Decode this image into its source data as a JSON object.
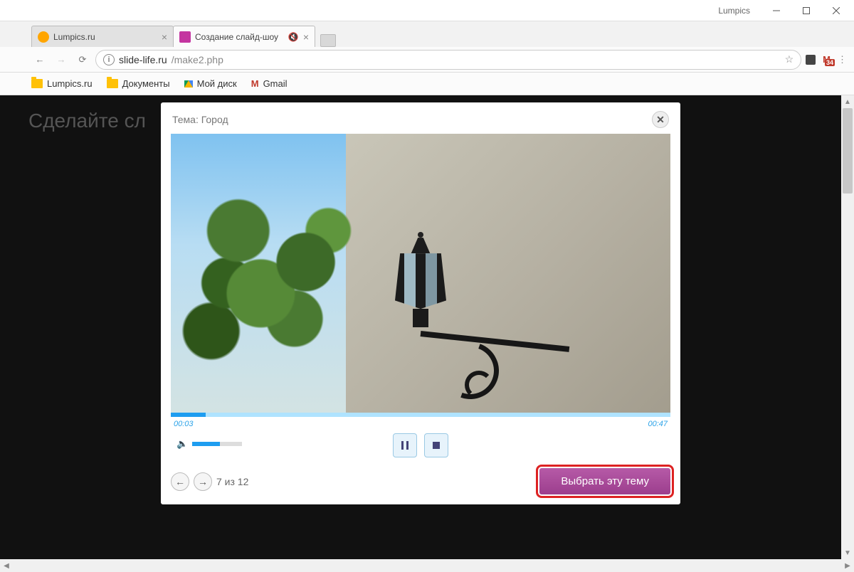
{
  "window": {
    "app_label": "Lumpics"
  },
  "tabs": [
    {
      "title": "Lumpics.ru",
      "favicon": "fav-lumpics",
      "active": false
    },
    {
      "title": "Создание слайд-шоу",
      "favicon": "fav-slide",
      "active": true,
      "muted": true
    }
  ],
  "address": {
    "host": "slide-life.ru",
    "path": "/make2.php"
  },
  "toolbar": {
    "gmail_badge": "34"
  },
  "bookmarks": [
    {
      "label": "Lumpics.ru",
      "icon": "folder"
    },
    {
      "label": "Документы",
      "icon": "folder"
    },
    {
      "label": "Мой диск",
      "icon": "drive"
    },
    {
      "label": "Gmail",
      "icon": "gm"
    }
  ],
  "backdrop": {
    "heading": "Сделайте сл"
  },
  "modal": {
    "title": "Тема: Город",
    "progress": {
      "elapsed": "00:03",
      "total": "00:47",
      "percent": 7
    },
    "pager": {
      "label": "7 из 12"
    },
    "select_button": "Выбрать эту тему"
  }
}
